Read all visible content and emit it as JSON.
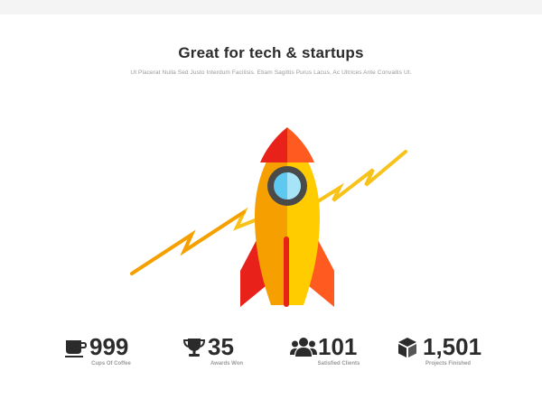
{
  "header": {
    "title": "Great for tech & startups",
    "subtitle": "Ut Placerat Nulla Sed Justo Interdum Facilisis. Etiam Sagittis Purus Lacus, Ac Ultrices Ante Convallis Ut."
  },
  "hero": {
    "illustration": "rocket-launch",
    "colors": {
      "trail": "#f7c21a",
      "body_left": "#f59f00",
      "body_right": "#ffcc00",
      "nose_left": "#e8221b",
      "nose_right": "#ff5a1f",
      "window_ring": "#4a4a4a",
      "window_glass": "#7fd4f5",
      "fin_left": "#e8221b",
      "fin_right": "#ff5a1f"
    }
  },
  "stats": [
    {
      "icon": "coffee-cup-icon",
      "value": "999",
      "label": "Cups Of Coffee"
    },
    {
      "icon": "trophy-icon",
      "value": "35",
      "label": "Awards Won"
    },
    {
      "icon": "users-icon",
      "value": "101",
      "label": "Satisfied Clients"
    },
    {
      "icon": "cube-icon",
      "value": "1,501",
      "label": "Projects Finished"
    }
  ]
}
